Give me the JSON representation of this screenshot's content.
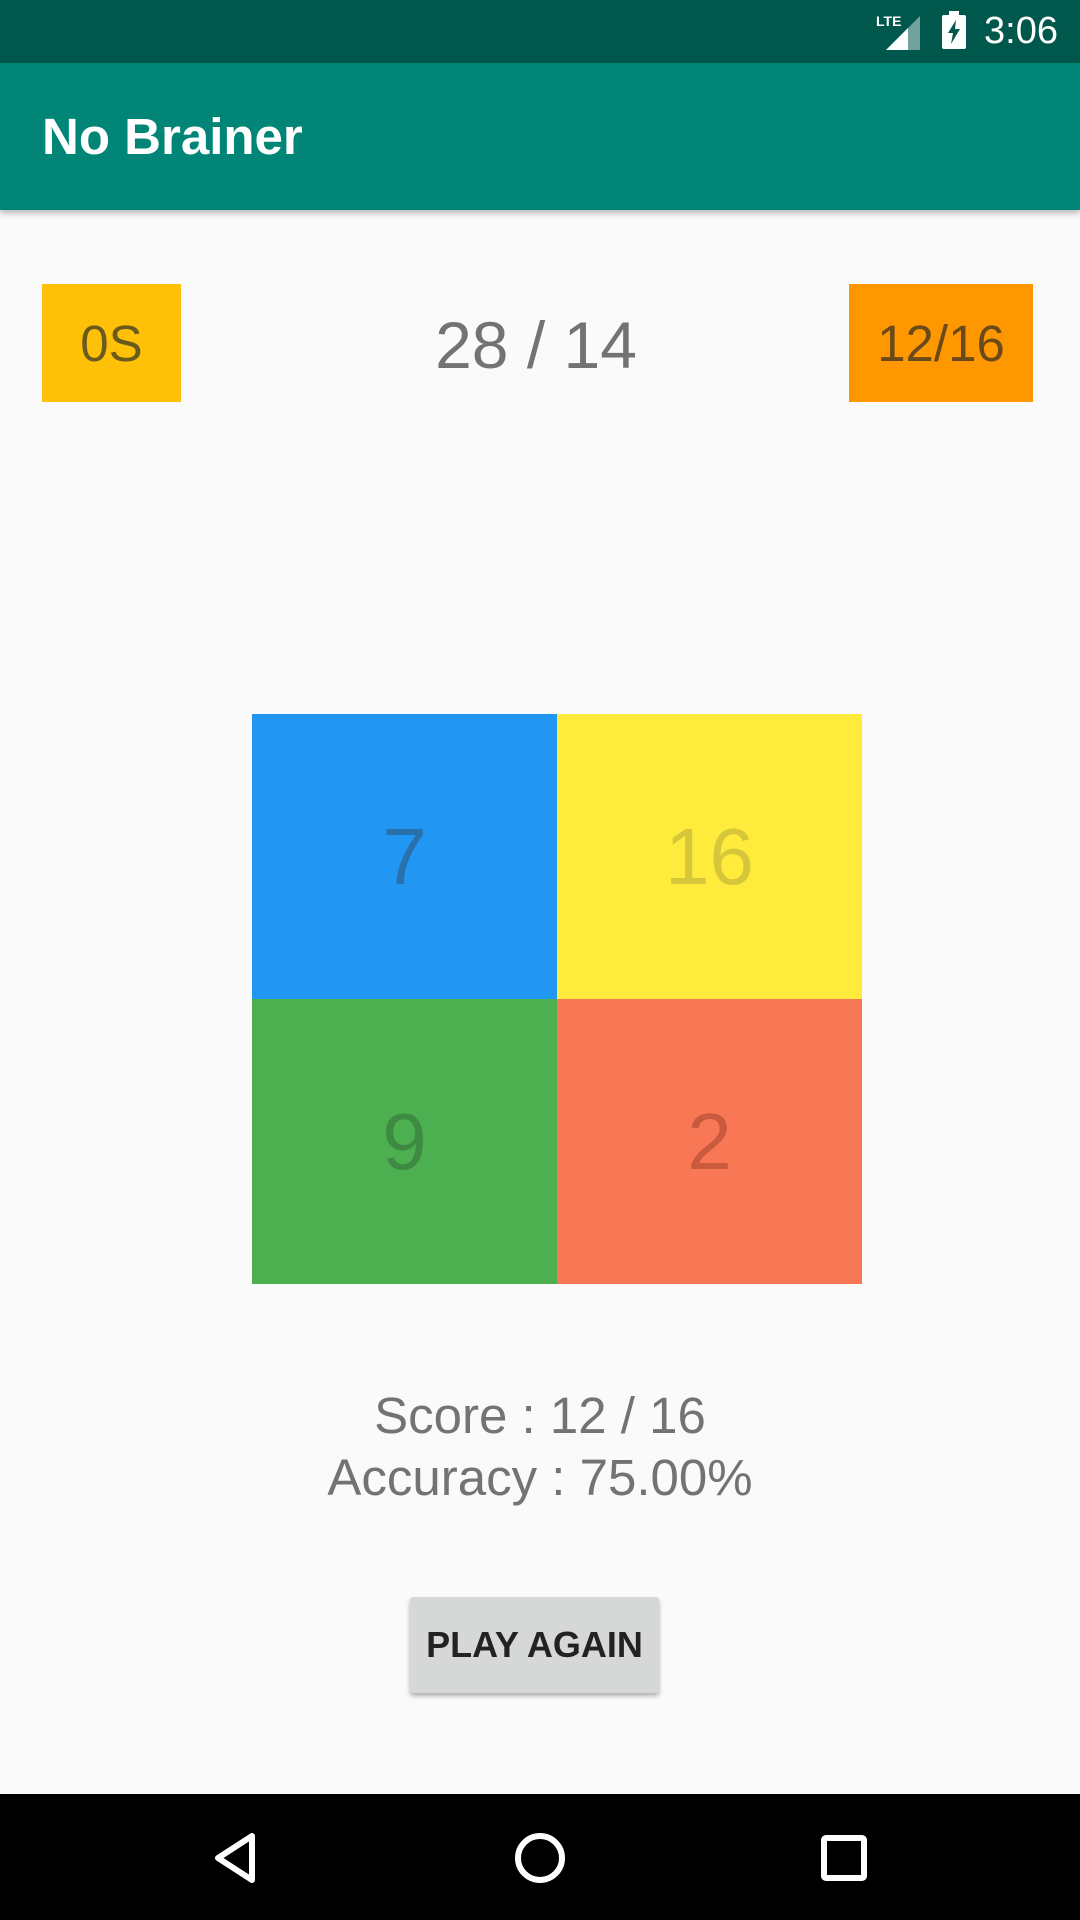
{
  "status_bar": {
    "network_label": "LTE",
    "time": "3:06",
    "icons": [
      "lte-signal-icon",
      "battery-charging-icon"
    ]
  },
  "app_bar": {
    "title": "No Brainer",
    "color": "#008577"
  },
  "game": {
    "timer": "0S",
    "question": "28 / 14",
    "score_badge": "12/16",
    "answers": [
      "7",
      "16",
      "9",
      "2"
    ],
    "answer_colors": [
      "#2196f3",
      "#ffeb3b",
      "#4caf50",
      "#f87855"
    ]
  },
  "result": {
    "score_line": "Score : 12 / 16",
    "accuracy_line": "Accuracy : 75.00%"
  },
  "play_again_label": "PLAY AGAIN",
  "nav_bar": {
    "icons": [
      "back-icon",
      "home-icon",
      "recents-icon"
    ]
  }
}
